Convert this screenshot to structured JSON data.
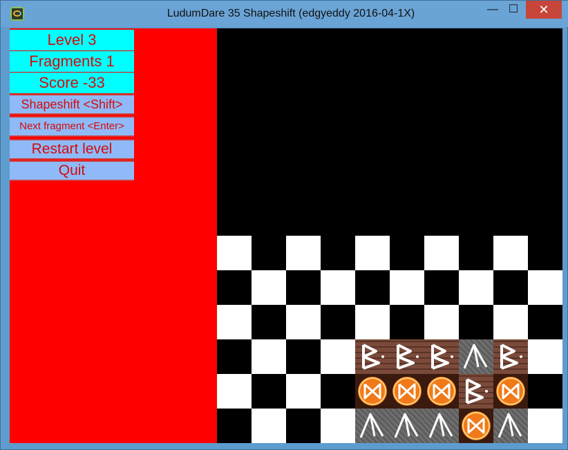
{
  "window": {
    "title": "LudumDare 35 Shapeshift (edgyeddy 2016-04-1X)",
    "minimize_glyph": "—",
    "maximize_glyph": "☐",
    "close_glyph": "✕"
  },
  "hud": {
    "level": "Level 3",
    "fragments": "Fragments 1",
    "score": "Score -33"
  },
  "menu": {
    "shapeshift": "Shapeshift <Shift>",
    "next_fragment": "Next fragment <Enter>",
    "restart": "Restart level",
    "quit": "Quit"
  },
  "colors": {
    "sidebar": "#ff0000",
    "hud_bg": "#00ffff",
    "menu_bg": "#8fbaf7",
    "text": "#d50b0b",
    "board_white": "#ffffff",
    "board_black": "#000000"
  },
  "board": {
    "columns": 10,
    "rows": 6,
    "pieces": [
      [
        "",
        "",
        "",
        "",
        "",
        "",
        "",
        "",
        "",
        ""
      ],
      [
        "",
        "",
        "",
        "",
        "",
        "",
        "",
        "",
        "",
        ""
      ],
      [
        "",
        "",
        "",
        "",
        "",
        "",
        "",
        "",
        "",
        ""
      ],
      [
        "",
        "",
        "",
        "",
        "B",
        "B",
        "B",
        "A",
        "B",
        ""
      ],
      [
        "",
        "",
        "",
        "",
        "X",
        "X",
        "X",
        "B",
        "X",
        ""
      ],
      [
        "",
        "",
        "",
        "",
        "A",
        "A",
        "A",
        "X",
        "A",
        ""
      ]
    ],
    "empty_top_row_color": "black"
  },
  "icons": {
    "app": "shapeshift-app-icon",
    "B": "rune-b-icon",
    "A": "rune-a-icon",
    "X": "rune-x-circle-icon"
  }
}
